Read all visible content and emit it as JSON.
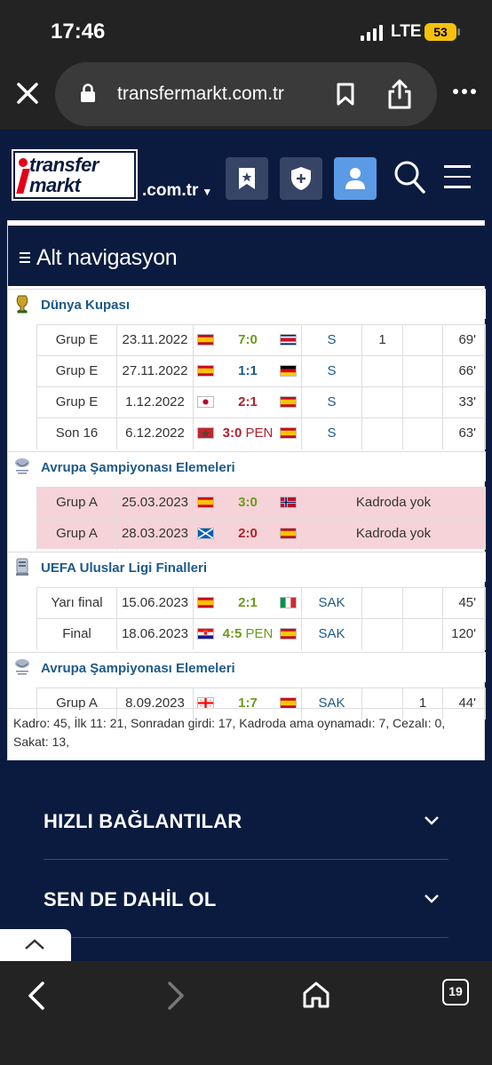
{
  "status_bar": {
    "time": "17:46",
    "network": "LTE",
    "battery": "53"
  },
  "browser": {
    "url": "transfermarkt.com.tr"
  },
  "site_header": {
    "logo_line1": "transfer",
    "logo_line2": "markt",
    "domain": ".com.tr"
  },
  "alt_nav": {
    "label": "Alt navigasyon"
  },
  "competitions": [
    {
      "name": "Dünya Kupası",
      "icon": "world-cup-trophy-icon",
      "matches": [
        {
          "group": "Grup E",
          "date": "23.11.2022",
          "flag1": "spain",
          "score": "7:0",
          "pen": "",
          "result": "win",
          "flag2": "costa-rica",
          "role": "S",
          "goals": "1",
          "assists": "",
          "minutes": "69'"
        },
        {
          "group": "Grup E",
          "date": "27.11.2022",
          "flag1": "spain",
          "score": "1:1",
          "pen": "",
          "result": "draw",
          "flag2": "germany",
          "role": "S",
          "goals": "",
          "assists": "",
          "minutes": "66'"
        },
        {
          "group": "Grup E",
          "date": "1.12.2022",
          "flag1": "japan",
          "score": "2:1",
          "pen": "",
          "result": "loss",
          "flag2": "spain",
          "role": "S",
          "goals": "",
          "assists": "",
          "minutes": "33'"
        },
        {
          "group": "Son 16",
          "date": "6.12.2022",
          "flag1": "morocco",
          "score": "3:0",
          "pen": "PEN",
          "result": "loss",
          "flag2": "spain",
          "role": "S",
          "goals": "",
          "assists": "",
          "minutes": "63'"
        }
      ]
    },
    {
      "name": "Avrupa Şampiyonası Elemeleri",
      "icon": "euro-qualifiers-icon",
      "matches": [
        {
          "group": "Grup A",
          "date": "25.03.2023",
          "flag1": "spain",
          "score": "3:0",
          "pen": "",
          "result": "win",
          "flag2": "norway",
          "note": "Kadroda yok"
        },
        {
          "group": "Grup A",
          "date": "28.03.2023",
          "flag1": "scotland",
          "score": "2:0",
          "pen": "",
          "result": "loss",
          "flag2": "spain",
          "note": "Kadroda yok"
        }
      ]
    },
    {
      "name": "UEFA Uluslar Ligi Finalleri",
      "icon": "nations-league-icon",
      "matches": [
        {
          "group": "Yarı final",
          "date": "15.06.2023",
          "flag1": "spain",
          "score": "2:1",
          "pen": "",
          "result": "win",
          "flag2": "italy",
          "role": "SAK",
          "goals": "",
          "assists": "",
          "minutes": "45'"
        },
        {
          "group": "Final",
          "date": "18.06.2023",
          "flag1": "croatia",
          "score": "4:5",
          "pen": "PEN",
          "result": "win",
          "flag2": "spain",
          "role": "SAK",
          "goals": "",
          "assists": "",
          "minutes": "120'"
        }
      ]
    },
    {
      "name": "Avrupa Şampiyonası Elemeleri",
      "icon": "euro-qualifiers-icon",
      "matches": [
        {
          "group": "Grup A",
          "date": "8.09.2023",
          "flag1": "georgia",
          "score": "1:7",
          "pen": "",
          "result": "win",
          "flag2": "spain",
          "role": "SAK",
          "goals": "",
          "assists": "1",
          "minutes": "44'"
        }
      ]
    }
  ],
  "summary": "Kadro: 45, İlk 11: 21, Sonradan girdi: 17, Kadroda ama oynamadı: 7, Cezalı: 0, Sakat: 13,",
  "footer": {
    "quick_links": "HIZLI BAĞLANTILAR",
    "join": "SEN DE DAHİL OL"
  },
  "bottom_bar": {
    "tab_count": "19"
  },
  "colors": {
    "navy": "#0b1b3f",
    "link": "#1d5a8a",
    "win": "#6b9a1c",
    "loss": "#b0202b",
    "absent_bg": "#f6d3d8",
    "accent": "#5b9be6"
  }
}
